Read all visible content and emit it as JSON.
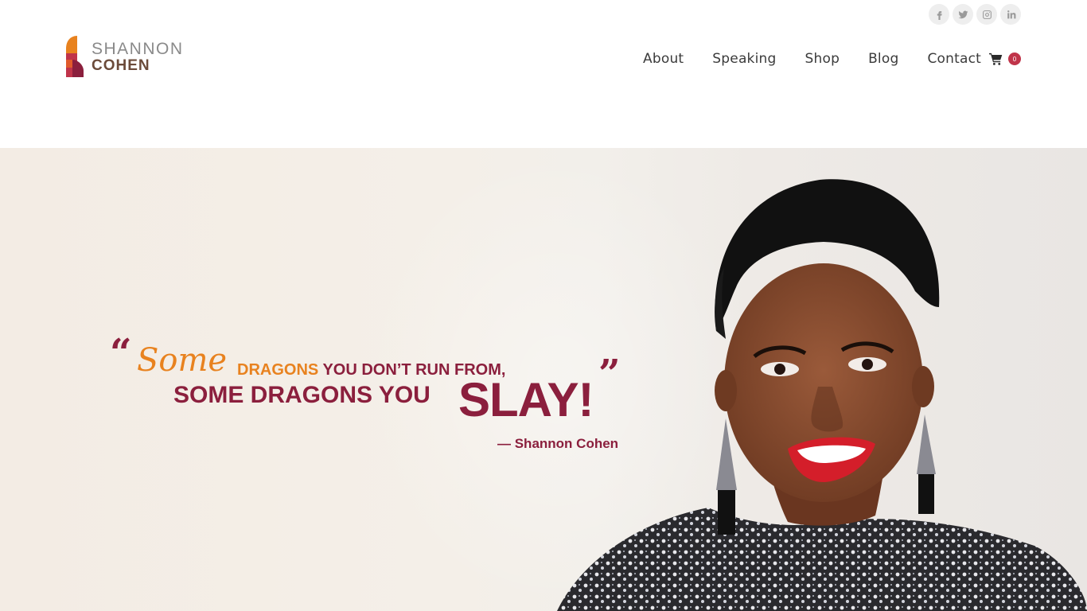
{
  "social": [
    {
      "name": "facebook-icon",
      "glyph": "f"
    },
    {
      "name": "twitter-icon",
      "glyph": "t"
    },
    {
      "name": "instagram-icon",
      "glyph": "ig"
    },
    {
      "name": "linkedin-icon",
      "glyph": "in"
    }
  ],
  "logo": {
    "line1": "SHANNON",
    "line2": "COHEN"
  },
  "nav": {
    "items": [
      "About",
      "Speaking",
      "Shop",
      "Blog",
      "Contact"
    ],
    "cart_count": "0"
  },
  "hero": {
    "quote_open": "“",
    "quote_close": "”",
    "some_script": "Some",
    "line1_orange": "DRAGONS",
    "line1_maroon": "YOU DON’T RUN FROM,",
    "line2": "SOME  DRAGONS YOU",
    "slay": "SLAY!",
    "attribution": "— Shannon Cohen"
  },
  "colors": {
    "brand_maroon": "#8b1f3d",
    "brand_orange": "#e8821f",
    "cart_badge": "#c0344a"
  }
}
